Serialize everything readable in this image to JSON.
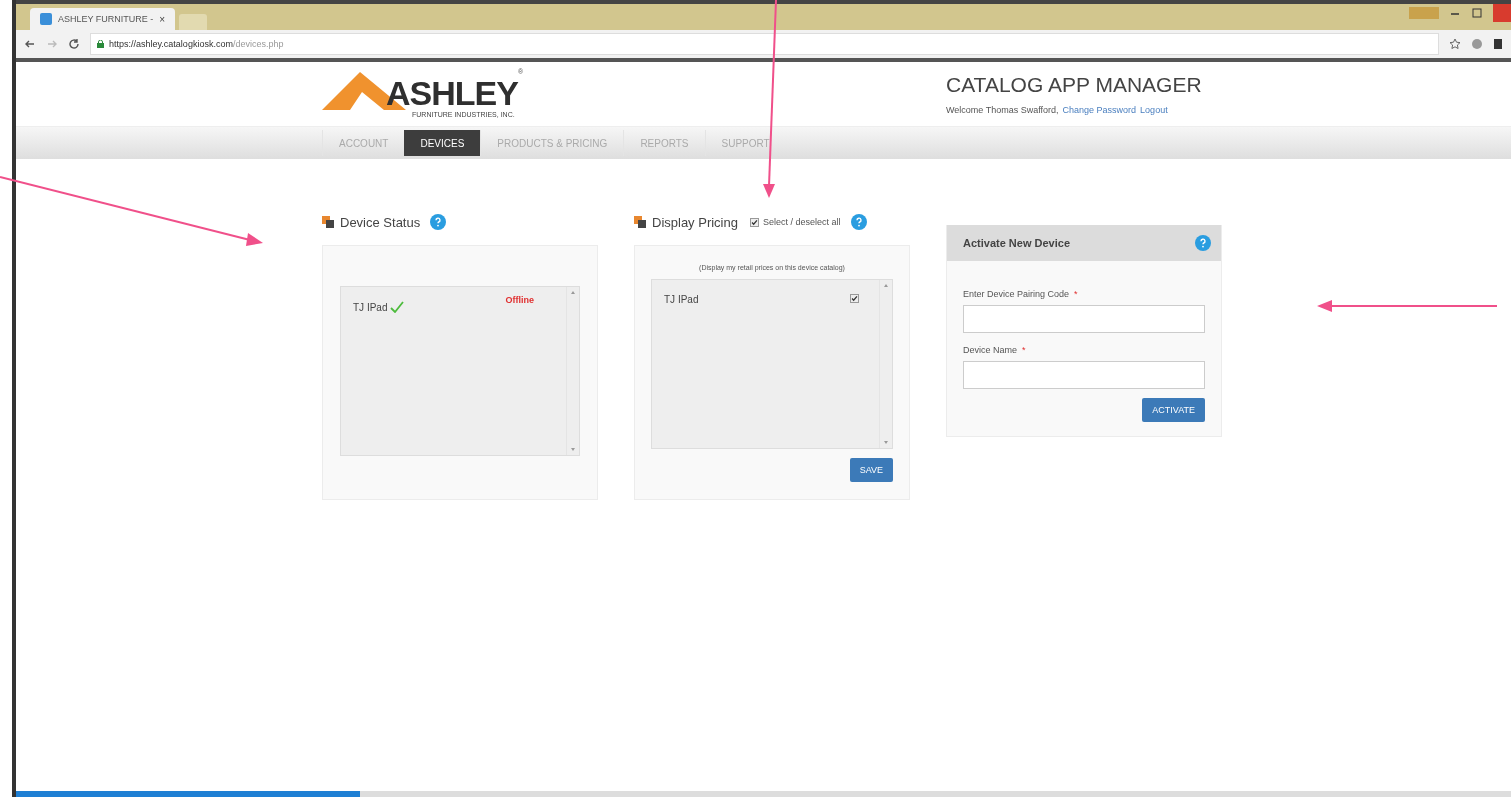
{
  "browser": {
    "tabs": [
      {
        "title": "ASHLEY FURNITURE -",
        "close": "×",
        "selected": true
      }
    ],
    "url_host": "https://ashley.catalogkiosk.com",
    "url_path": "/devices.php"
  },
  "logo": {
    "name": "ASHLEY",
    "mark": "®",
    "subtitle": "FURNITURE INDUSTRIES, INC."
  },
  "header": {
    "title": "CATALOG APP MANAGER",
    "welcome": "Welcome Thomas Swafford,",
    "links": [
      "Change Password",
      "Logout"
    ]
  },
  "nav": [
    {
      "label": "ACCOUNT",
      "selected": false
    },
    {
      "label": "DEVICES",
      "selected": true
    },
    {
      "label": "PRODUCTS & PRICING",
      "selected": false
    },
    {
      "label": "REPORTS",
      "selected": false
    },
    {
      "label": "SUPPORT",
      "selected": false
    }
  ],
  "device_status": {
    "title": "Device Status",
    "devices": [
      {
        "name": "TJ IPad",
        "verified": true,
        "status": "Offline"
      }
    ]
  },
  "display_pricing": {
    "title": "Display Pricing",
    "select_all": {
      "label": "Select / deselect all",
      "checked": true
    },
    "caption": "(Display my retail prices on this device catalog)",
    "devices": [
      {
        "name": "TJ IPad",
        "checked": true
      }
    ],
    "save": "SAVE"
  },
  "activate": {
    "title": "Activate New Device",
    "fields": [
      {
        "label": "Enter Device Pairing Code",
        "required_mark": "*"
      },
      {
        "label": "Device Name",
        "required_mark": "*"
      }
    ],
    "button": "ACTIVATE"
  },
  "loading": {
    "level": 0.23
  }
}
